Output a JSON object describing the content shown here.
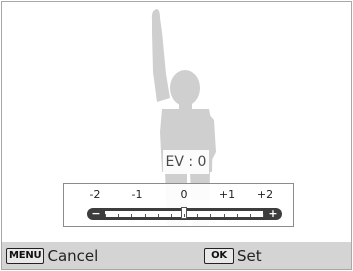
{
  "exposure": {
    "label": "EV : 0",
    "value": 0,
    "range": [
      -2,
      2
    ],
    "step": 0.333,
    "scale_labels": [
      "-2",
      "-1",
      "0",
      "+1",
      "+2"
    ],
    "minus_symbol": "−",
    "plus_symbol": "+"
  },
  "bottom_bar": {
    "menu_key": "MENU",
    "cancel_label": "Cancel",
    "ok_key": "OK",
    "set_label": "Set"
  },
  "colors": {
    "silhouette": "#cfcfcf",
    "bar": "#3d3d3d",
    "bottom_bar": "#cdcdcd"
  }
}
